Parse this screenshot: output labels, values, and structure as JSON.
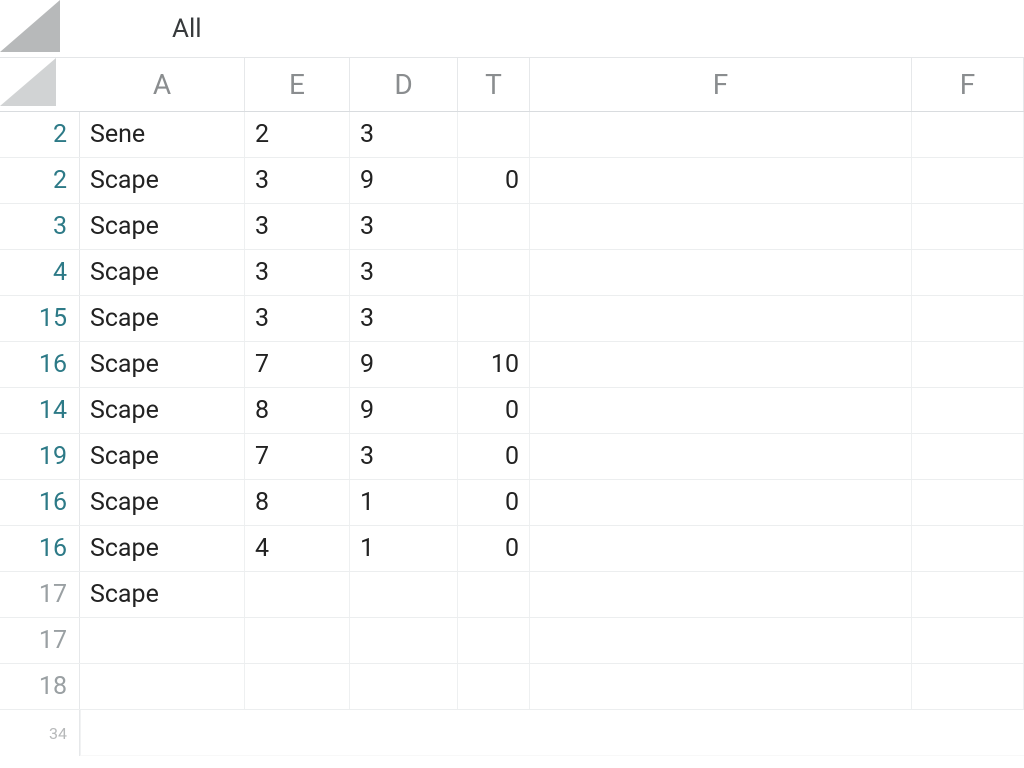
{
  "chart_data": {
    "type": "table",
    "columns": [
      "A",
      "E",
      "D",
      "T",
      "F",
      "F"
    ],
    "row_labels": [
      "2",
      "2",
      "3",
      "4",
      "15",
      "16",
      "14",
      "19",
      "16",
      "16",
      "17",
      "17",
      "18"
    ],
    "rows": [
      [
        "Sene",
        "2",
        "3",
        "",
        "",
        ""
      ],
      [
        "Scape",
        "3",
        "9",
        "0",
        "",
        ""
      ],
      [
        "Scape",
        "3",
        "3",
        "",
        "",
        ""
      ],
      [
        "Scape",
        "3",
        "3",
        "",
        "",
        ""
      ],
      [
        "Scape",
        "3",
        "3",
        "",
        "",
        ""
      ],
      [
        "Scape",
        "7",
        "9",
        "10",
        "",
        ""
      ],
      [
        "Scape",
        "8",
        "9",
        "0",
        "",
        ""
      ],
      [
        "Scape",
        "7",
        "3",
        "0",
        "",
        ""
      ],
      [
        "Scape",
        "8",
        "1",
        "0",
        "",
        ""
      ],
      [
        "Scape",
        "4",
        "1",
        "0",
        "",
        ""
      ],
      [
        "Scape",
        "",
        "",
        "",
        "",
        ""
      ],
      [
        "",
        "",
        "",
        "",
        "",
        ""
      ],
      [
        "",
        "",
        "",
        "",
        "",
        ""
      ]
    ],
    "trailing_row_label": "34",
    "dropdown_label": "All"
  },
  "topbar": {
    "dropdown": "All"
  },
  "cols": {
    "c0": "A",
    "c1": "E",
    "c2": "D",
    "c3": "T",
    "c4": "F",
    "c5": "F"
  },
  "rows": {
    "r0": {
      "h": "2",
      "a": "Sene",
      "e": "2",
      "d": "3",
      "t": ""
    },
    "r1": {
      "h": "2",
      "a": "Scape",
      "e": "3",
      "d": "9",
      "t": "0"
    },
    "r2": {
      "h": "3",
      "a": "Scape",
      "e": "3",
      "d": "3",
      "t": ""
    },
    "r3": {
      "h": "4",
      "a": "Scape",
      "e": "3",
      "d": "3",
      "t": ""
    },
    "r4": {
      "h": "15",
      "a": "Scape",
      "e": "3",
      "d": "3",
      "t": ""
    },
    "r5": {
      "h": "16",
      "a": "Scape",
      "e": "7",
      "d": "9",
      "t": "10"
    },
    "r6": {
      "h": "14",
      "a": "Scape",
      "e": "8",
      "d": "9",
      "t": "0"
    },
    "r7": {
      "h": "19",
      "a": "Scape",
      "e": "7",
      "d": "3",
      "t": "0"
    },
    "r8": {
      "h": "16",
      "a": "Scape",
      "e": "8",
      "d": "1",
      "t": "0"
    },
    "r9": {
      "h": "16",
      "a": "Scape",
      "e": "4",
      "d": "1",
      "t": "0"
    },
    "r10": {
      "h": "17",
      "a": "Scape",
      "e": "",
      "d": "",
      "t": ""
    },
    "r11": {
      "h": "17",
      "a": "",
      "e": "",
      "d": "",
      "t": ""
    },
    "r12": {
      "h": "18",
      "a": "",
      "e": "",
      "d": "",
      "t": ""
    }
  },
  "trailing": {
    "h": "34"
  }
}
